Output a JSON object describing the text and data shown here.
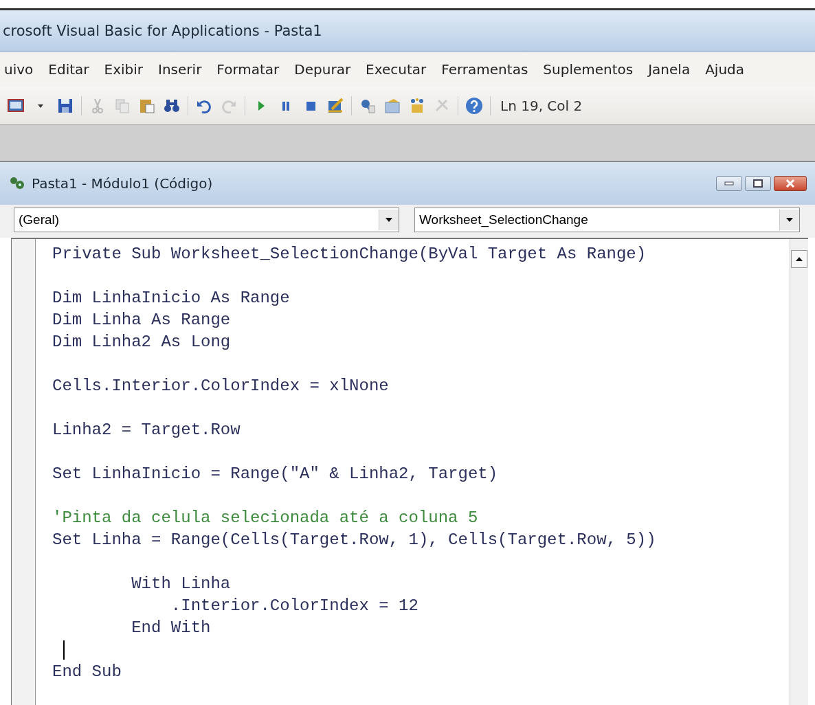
{
  "window": {
    "title": "crosoft Visual Basic for Applications - Pasta1"
  },
  "menu": [
    "uivo",
    "Editar",
    "Exibir",
    "Inserir",
    "Formatar",
    "Depurar",
    "Executar",
    "Ferramentas",
    "Suplementos",
    "Janela",
    "Ajuda"
  ],
  "toolbar": {
    "position": "Ln 19, Col 2"
  },
  "code_window": {
    "title": "Pasta1 - Módulo1 (Código)",
    "object_dropdown": "(Geral)",
    "procedure_dropdown": "Worksheet_SelectionChange",
    "lines": [
      {
        "kind": "code",
        "text": "Private Sub Worksheet_SelectionChange(ByVal Target As Range)"
      },
      {
        "kind": "blank"
      },
      {
        "kind": "code",
        "text": "Dim LinhaInicio As Range"
      },
      {
        "kind": "code",
        "text": "Dim Linha As Range"
      },
      {
        "kind": "code",
        "text": "Dim Linha2 As Long"
      },
      {
        "kind": "blank"
      },
      {
        "kind": "code",
        "text": "Cells.Interior.ColorIndex = xlNone"
      },
      {
        "kind": "blank"
      },
      {
        "kind": "code",
        "text": "Linha2 = Target.Row"
      },
      {
        "kind": "blank"
      },
      {
        "kind": "code",
        "text": "Set LinhaInicio = Range(\"A\" & Linha2, Target)"
      },
      {
        "kind": "blank"
      },
      {
        "kind": "comment",
        "text": "'Pinta da celula selecionada até a coluna 5"
      },
      {
        "kind": "code",
        "text": "Set Linha = Range(Cells(Target.Row, 1), Cells(Target.Row, 5))"
      },
      {
        "kind": "blank"
      },
      {
        "kind": "code",
        "text": "        With Linha"
      },
      {
        "kind": "code",
        "text": "            .Interior.ColorIndex = 12"
      },
      {
        "kind": "code",
        "text": "        End With"
      },
      {
        "kind": "cursor"
      },
      {
        "kind": "code",
        "text": "End Sub"
      }
    ]
  }
}
